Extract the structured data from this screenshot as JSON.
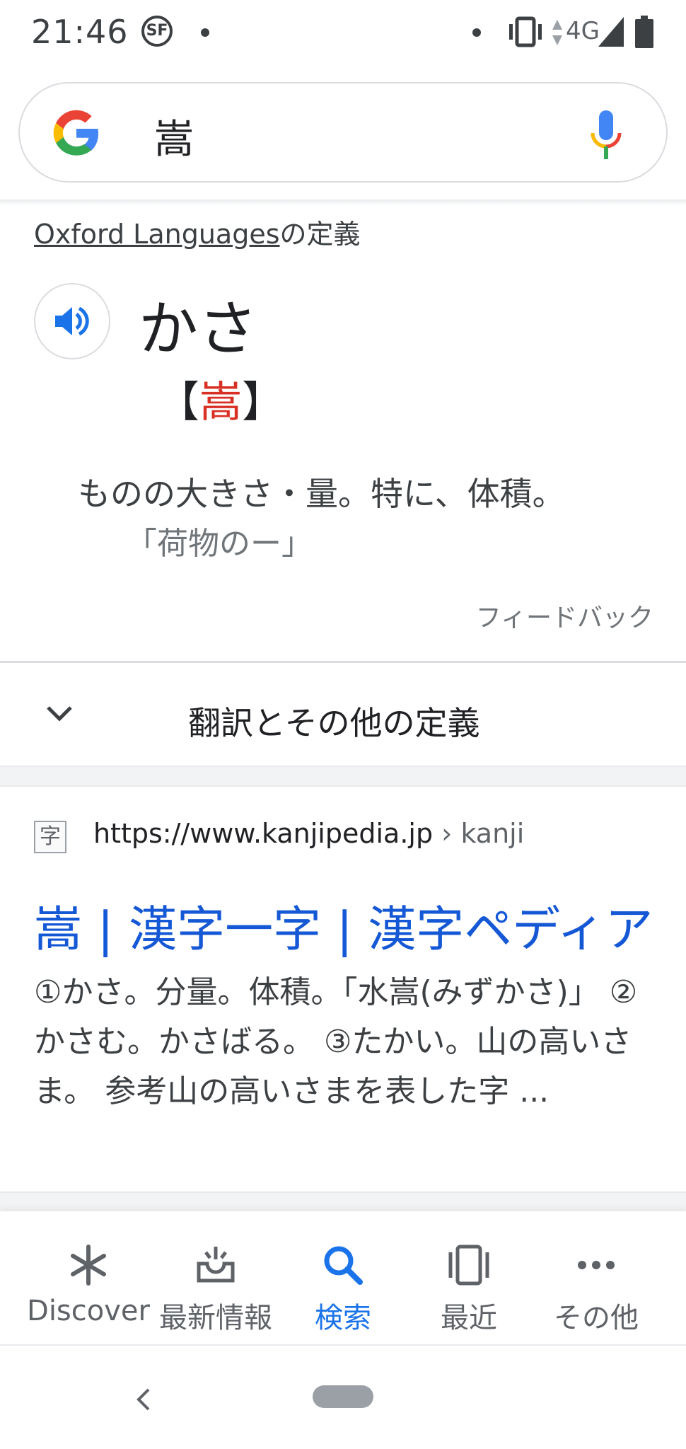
{
  "status_bar": {
    "time": "21:46",
    "app_badge": "SF",
    "network": "4G"
  },
  "search": {
    "query": "嵩",
    "logo": "google-g-logo",
    "mic_icon": "mic-icon"
  },
  "definition": {
    "source_link": "Oxford Languages",
    "source_suffix": "の定義",
    "word": "かさ",
    "kanji_open": "【",
    "kanji": "嵩",
    "kanji_close": "】",
    "meaning": "ものの大きさ・量。特に、体積。",
    "example": "「荷物のー」",
    "feedback": "フィードバック"
  },
  "more_definitions": {
    "label": "翻訳とその他の定義"
  },
  "result": {
    "favicon_char": "字",
    "url": "https://www.kanjipedia.jp",
    "url_path": " › kanji",
    "title": "嵩 | 漢字一字 | 漢字ペディア",
    "snippet": "①かさ。分量。体積。「水嵩(みずかさ)」 ②かさむ。かさばる。 ③たかい。山の高いさま。 参考山の高いさまを表した字 ..."
  },
  "bottom_nav": {
    "items": [
      {
        "label": "Discover",
        "icon": "asterisk-icon"
      },
      {
        "label": "最新情報",
        "icon": "updates-icon"
      },
      {
        "label": "検索",
        "icon": "search-icon",
        "active": true
      },
      {
        "label": "最近",
        "icon": "recent-icon"
      },
      {
        "label": "その他",
        "icon": "more-icon"
      }
    ]
  },
  "colors": {
    "accent": "#1a73e8",
    "link": "#1558d6",
    "kanji_red": "#d93025"
  }
}
